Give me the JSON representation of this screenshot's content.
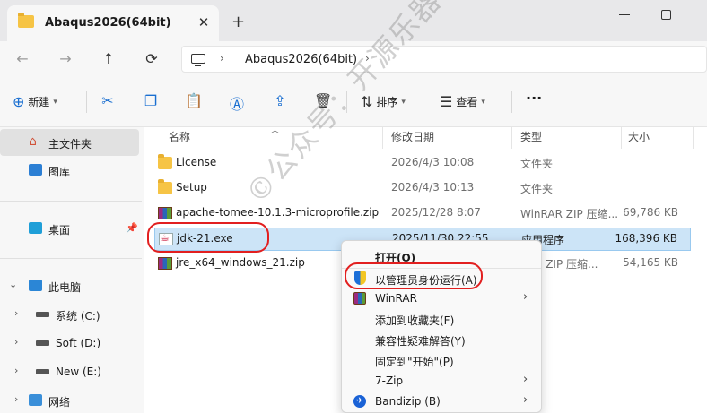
{
  "tab": {
    "title": "Abaqus2026(64bit)",
    "close_glyph": "✕",
    "new_glyph": "+"
  },
  "nav": {
    "back": "←",
    "forward": "→",
    "up": "↑",
    "refresh": "⟳"
  },
  "address": {
    "path": "Abaqus2026(64bit)",
    "chevron": "›"
  },
  "toolbar": {
    "new_label": "新建",
    "sort_label": "排序",
    "view_label": "查看",
    "more": "···"
  },
  "sidebar": {
    "items": [
      {
        "label": "主文件夹",
        "icon": "home-icon"
      },
      {
        "label": "图库",
        "icon": "gallery-icon"
      },
      {
        "label": "桌面",
        "icon": "desktop-icon"
      },
      {
        "label": "此电脑",
        "icon": "computer-icon"
      },
      {
        "label": "系统 (C:)",
        "icon": "drive-icon"
      },
      {
        "label": "Soft (D:)",
        "icon": "drive-icon"
      },
      {
        "label": "New (E:)",
        "icon": "drive-icon"
      },
      {
        "label": "网络",
        "icon": "network-icon"
      }
    ]
  },
  "columns": {
    "name": "名称",
    "date": "修改日期",
    "type": "类型",
    "size": "大小"
  },
  "files": [
    {
      "name": "License",
      "date": "2026/4/3 10:08",
      "type": "文件夹",
      "size": "",
      "icon": "folder"
    },
    {
      "name": "Setup",
      "date": "2026/4/3 10:13",
      "type": "文件夹",
      "size": "",
      "icon": "folder"
    },
    {
      "name": "apache-tomee-10.1.3-microprofile.zip",
      "date": "2025/12/28 8:07",
      "type": "WinRAR ZIP 压缩...",
      "size": "69,786 KB",
      "icon": "winrar-archive"
    },
    {
      "name": "jdk-21.exe",
      "date": "2025/11/30 22:55",
      "type": "应用程序",
      "size": "168,396 KB",
      "icon": "java-exe"
    },
    {
      "name": "jre_x64_windows_21.zip",
      "date": "",
      "type": "RAR ZIP 压缩...",
      "size": "54,165 KB",
      "icon": "winrar-archive"
    }
  ],
  "context_menu": {
    "items": [
      {
        "label": "打开(O)",
        "bold": true
      },
      {
        "label": "以管理员身份运行(A)",
        "icon": "uac-shield-icon"
      },
      {
        "label": "WinRAR",
        "icon": "winrar-icon",
        "submenu": true
      },
      {
        "label": "添加到收藏夹(F)"
      },
      {
        "label": "兼容性疑难解答(Y)"
      },
      {
        "label": "固定到\"开始\"(P)"
      },
      {
        "label": "7-Zip",
        "submenu": true
      },
      {
        "label": "Bandizip (B)",
        "icon": "bandizip-icon",
        "submenu": true
      }
    ]
  },
  "watermark": "©公众号：开源乐器",
  "colors": {
    "selection": "#cce4f7",
    "annotation": "#e21f1f",
    "accent": "#1a6fd1"
  }
}
